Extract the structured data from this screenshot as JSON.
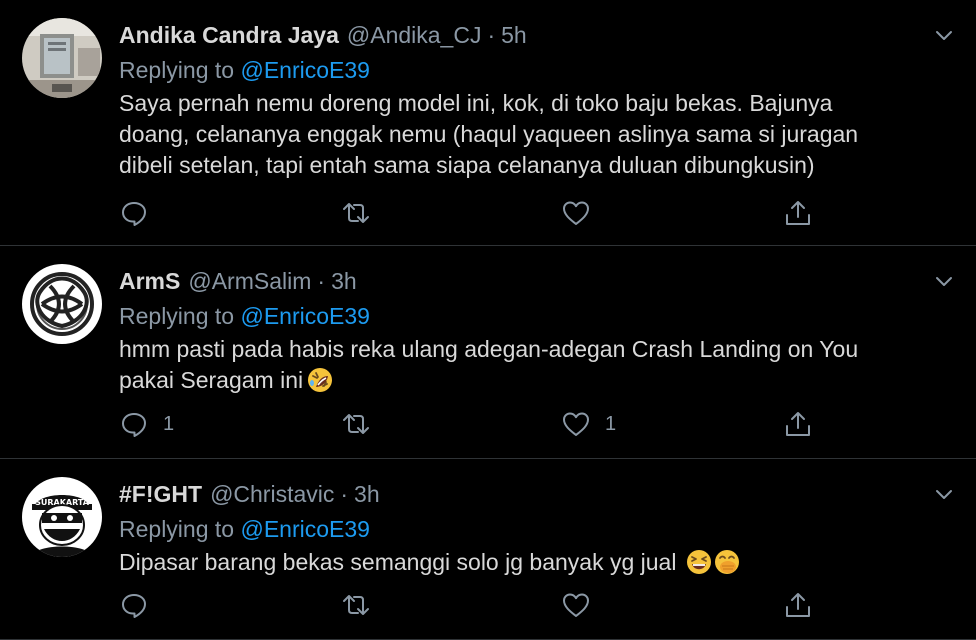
{
  "tweets": [
    {
      "name": "Andika Candra Jaya",
      "handle": "@Andika_CJ",
      "separator": "·",
      "time": "5h",
      "replying_prefix": "Replying to ",
      "replying_to": "@EnricoE39",
      "text_lines": [
        "Saya pernah nemu doreng model ini, kok, di toko baju bekas. Bajunya",
        "doang, celananya enggak nemu (haqul yaqueen aslinya sama si juragan",
        "dibeli setelan, tapi entah sama siapa celananya duluan dibungkusin)"
      ],
      "reply_count": "",
      "retweet_count": "",
      "like_count": ""
    },
    {
      "name": "ArmS",
      "handle": "@ArmSalim",
      "separator": "·",
      "time": "3h",
      "replying_prefix": "Replying to ",
      "replying_to": "@EnricoE39",
      "text_lines": [
        "hmm pasti pada habis reka ulang adegan-adegan Crash Landing on You",
        "pakai Seragam ini"
      ],
      "emojis": [
        "rolling-on-floor-laughing-emoji"
      ],
      "reply_count": "1",
      "retweet_count": "",
      "like_count": "1"
    },
    {
      "name": "#F!GHT",
      "handle": "@Christavic",
      "separator": "·",
      "time": "3h",
      "replying_prefix": "Replying to ",
      "replying_to": "@EnricoE39",
      "text_lines": [
        "Dipasar barang bekas semanggi solo jg banyak yg jual"
      ],
      "emojis": [
        "grinning-squinting-face-emoji",
        "face-with-hand-over-mouth-emoji"
      ],
      "avatar_text": "SURAKARTA",
      "reply_count": "",
      "retweet_count": "",
      "like_count": ""
    }
  ],
  "icons": {
    "reply": "reply-icon",
    "retweet": "retweet-icon",
    "like": "like-icon",
    "share": "share-icon",
    "more": "chevron-down-icon"
  },
  "colors": {
    "background": "#000000",
    "text": "#d9d9d9",
    "muted": "#8b98a5",
    "link": "#1d9bf0",
    "divider": "#2f3336"
  }
}
